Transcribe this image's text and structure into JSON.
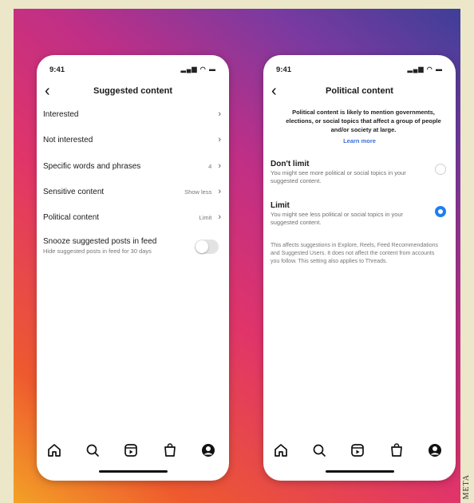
{
  "credit": "META",
  "status_bar": {
    "time": "9:41",
    "icons": "signal-wifi-battery"
  },
  "left_screen": {
    "title": "Suggested content",
    "rows": [
      {
        "label": "Interested",
        "value": ""
      },
      {
        "label": "Not interested",
        "value": ""
      },
      {
        "label": "Specific words and phrases",
        "value": "4"
      },
      {
        "label": "Sensitive content",
        "value": "Show less"
      },
      {
        "label": "Political content",
        "value": "Limit"
      }
    ],
    "snooze": {
      "title": "Snooze suggested posts in feed",
      "subtitle": "Hide suggested posts in feed for 30 days",
      "enabled": false
    }
  },
  "right_screen": {
    "title": "Political content",
    "intro": "Political content is likely to mention governments, elections, or social topics that affect a group of people and/or society at large.",
    "learn_more": "Learn more",
    "options": [
      {
        "title": "Don't limit",
        "desc": "You might see more political or social topics in your suggested content.",
        "selected": false
      },
      {
        "title": "Limit",
        "desc": "You might see less political or social topics in your suggested content.",
        "selected": true
      }
    ],
    "note": "This affects suggestions in Explore, Reels, Feed Recommendations and Suggested Users. It does not affect the content from accounts you follow. This setting also applies to Threads."
  },
  "tab_icons": [
    "home-icon",
    "search-icon",
    "reels-icon",
    "shop-icon",
    "profile-icon"
  ],
  "colors": {
    "accent": "#1f7ef0",
    "link": "#3b6fd6"
  }
}
